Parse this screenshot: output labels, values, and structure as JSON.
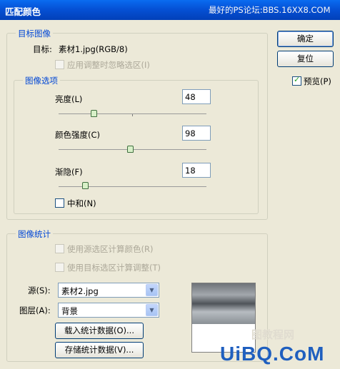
{
  "window": {
    "title": "匹配颜色",
    "forum_text": "最好的PS论坛:BBS.16XX8.COM"
  },
  "target_image": {
    "legend": "目标图像",
    "target_label": "目标:",
    "target_value": "素材1.jpg(RGB/8)",
    "ignore_selection": {
      "label": "应用调整时忽略选区(I)",
      "checked": false,
      "enabled": false
    }
  },
  "image_options": {
    "legend": "图像选项",
    "luminance": {
      "label": "亮度(L)",
      "value": "48",
      "slider_fraction": 0.24
    },
    "color_intensity": {
      "label": "颜色强度(C)",
      "value": "98",
      "slider_fraction": 0.49
    },
    "fade": {
      "label": "渐隐(F)",
      "value": "18",
      "slider_fraction": 0.18
    },
    "neutralize": {
      "label": "中和(N)",
      "checked": false
    }
  },
  "image_statistics": {
    "legend": "图像统计",
    "use_source_selection": {
      "label": "使用源选区计算颜色(R)",
      "checked": false,
      "enabled": false
    },
    "use_target_selection": {
      "label": "使用目标选区计算调整(T)",
      "checked": false,
      "enabled": false
    },
    "source": {
      "label": "源(S):",
      "value": "素材2.jpg"
    },
    "layer": {
      "label": "图层(A):",
      "value": "背景"
    },
    "load_button": "载入统计数据(O)...",
    "save_button": "存储统计数据(V)..."
  },
  "buttons": {
    "ok": "确定",
    "reset": "复位"
  },
  "preview": {
    "label": "预览(P)",
    "checked": true
  },
  "watermarks": {
    "site_cn": "图教程网",
    "site_logo": "UiBQ.CoM"
  }
}
